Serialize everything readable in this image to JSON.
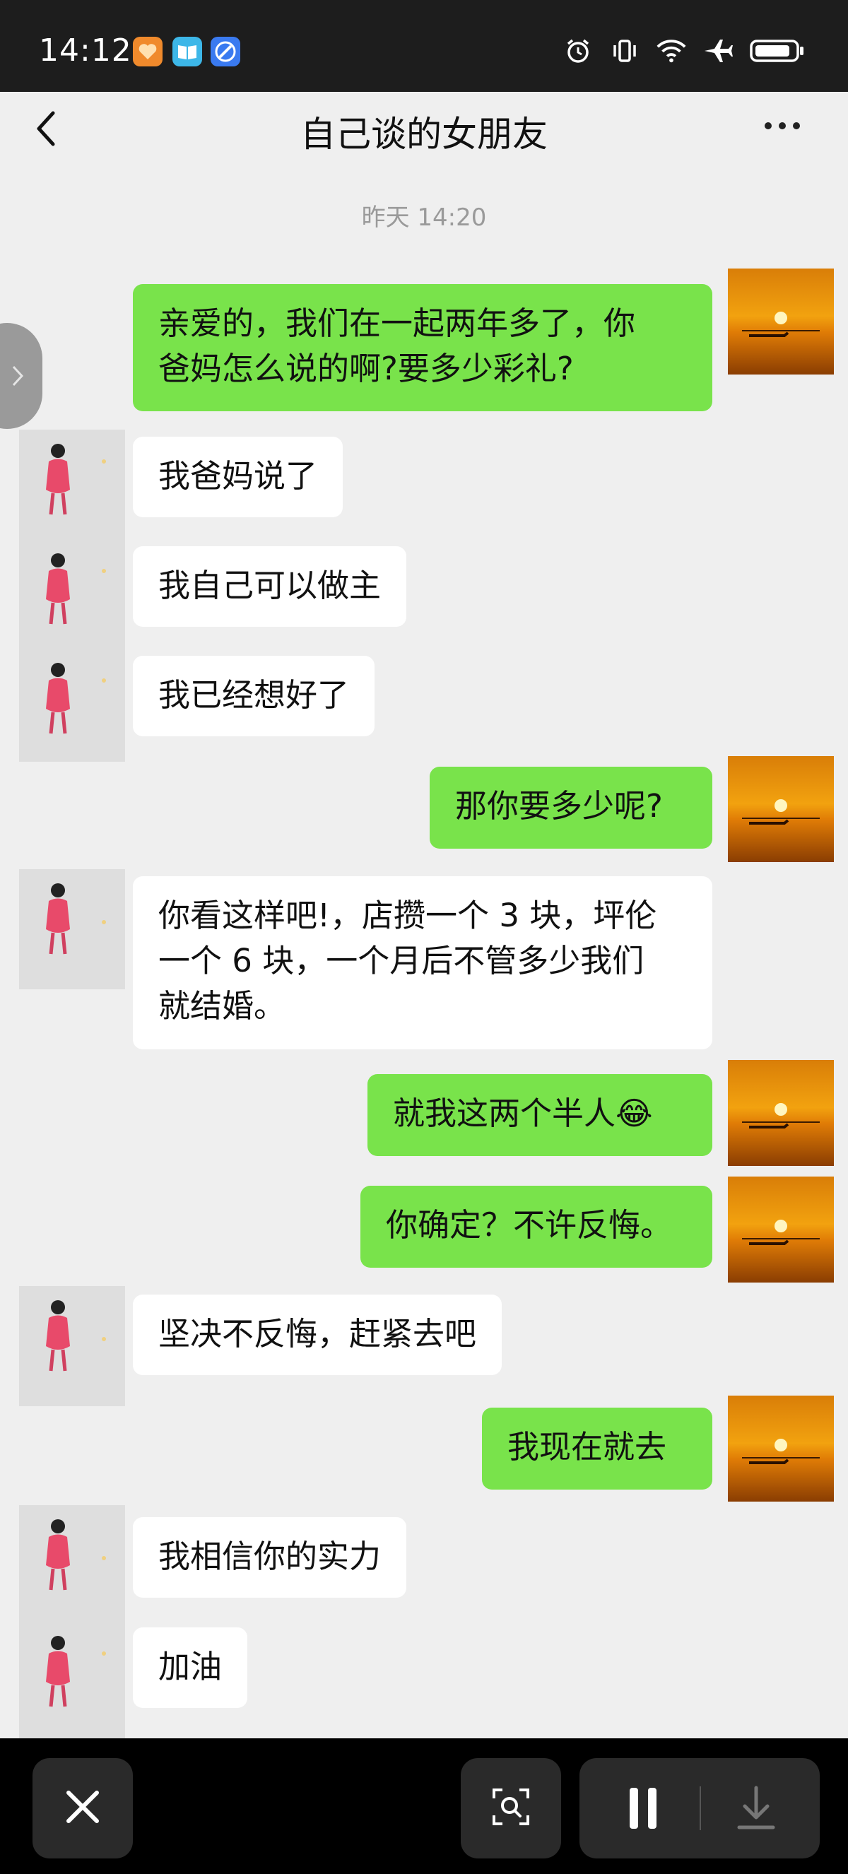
{
  "status_bar": {
    "time": "14:12",
    "app_icons": [
      "orange-heart-app-icon",
      "book-app-icon",
      "browser-app-icon"
    ],
    "right_icons": [
      "alarm-icon",
      "vibrate-icon",
      "wifi-icon",
      "airplane-icon",
      "battery-icon"
    ]
  },
  "chat": {
    "title": "自己谈的女朋友",
    "timestamp": "昨天 14:20",
    "messages": [
      {
        "side": "right",
        "text_line1": "亲爱的，我们在一起两年多了，你",
        "text_line2": "爸妈怎么说的啊?要多少彩礼?"
      },
      {
        "side": "left",
        "text": "我爸妈说了"
      },
      {
        "side": "left",
        "text": "我自己可以做主"
      },
      {
        "side": "left",
        "text": "我已经想好了"
      },
      {
        "side": "right",
        "text": "那你要多少呢?"
      },
      {
        "side": "left",
        "text_line1": "你看这样吧!，店攒一个 3 块，坪伦",
        "text_line2": "一个 6 块，一个月后不管多少我们",
        "text_line3": "就结婚。"
      },
      {
        "side": "right",
        "text": "就我这两个半人",
        "emoji": "😂"
      },
      {
        "side": "right",
        "text": "你确定？不许反悔。"
      },
      {
        "side": "left",
        "text": "坚决不反悔，赶紧去吧"
      },
      {
        "side": "right",
        "text": "我现在就去"
      },
      {
        "side": "left",
        "text": "我相信你的实力"
      },
      {
        "side": "left",
        "text": "加油"
      }
    ]
  },
  "bottom_bar": {
    "buttons": [
      "close-icon",
      "screenshot-search-icon",
      "pause-icon",
      "download-icon"
    ]
  },
  "colors": {
    "sent_bubble": "#79e34b",
    "received_bubble": "#ffffff",
    "chat_background": "#efefef"
  }
}
